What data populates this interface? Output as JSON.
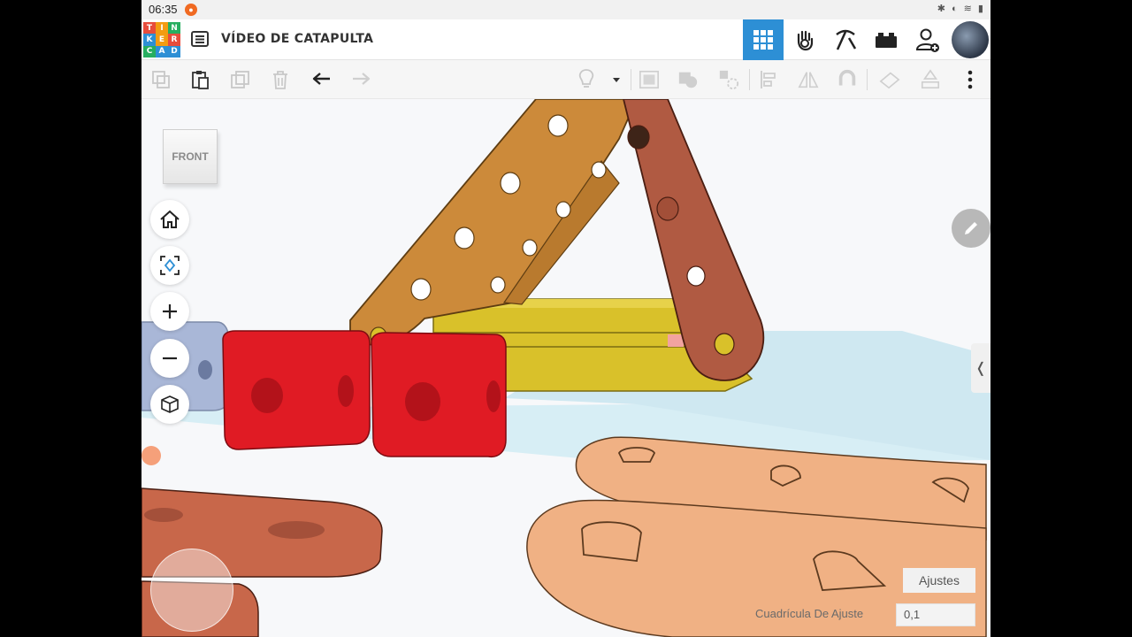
{
  "statusbar": {
    "time": "06:35"
  },
  "header": {
    "logo_letters": [
      "T",
      "I",
      "N",
      "K",
      "E",
      "R",
      "C",
      "A",
      "D"
    ],
    "logo_colors": [
      "#e74c3c",
      "#f39c12",
      "#27ae60",
      "#2d8fd5",
      "#f39c12",
      "#e74c3c",
      "#27ae60",
      "#2d8fd5",
      "#2d8fd5"
    ],
    "title": "VÍDEO DE CATAPULTA",
    "buttons": [
      {
        "icon": "grid-view-icon",
        "active": true
      },
      {
        "icon": "hand-sim-icon",
        "active": false
      },
      {
        "icon": "pickaxe-icon",
        "active": false
      },
      {
        "icon": "brick-icon",
        "active": false
      },
      {
        "icon": "add-user-icon",
        "active": false
      }
    ]
  },
  "toolbar": {
    "items": [
      "copy-icon",
      "paste-icon",
      "duplicate-icon",
      "delete-icon",
      "undo-icon",
      "redo-icon",
      "light-icon",
      "dropdown-icon",
      "group-icon",
      "ungroup-icon",
      "hole-icon",
      "align-icon",
      "mirror-icon",
      "magnet-icon",
      "cruise-icon",
      "workplane-icon",
      "more-icon"
    ]
  },
  "viewcube": {
    "label": "FRONT"
  },
  "nav": [
    "home-icon",
    "fit-view-icon",
    "zoom-in-icon",
    "zoom-out-icon",
    "perspective-icon"
  ],
  "settings": {
    "button_label": "Ajustes",
    "snap_label": "Cuadrícula De Ajuste",
    "snap_value": "0,1"
  },
  "colors": {
    "accent": "#2d8fd5",
    "orange_arm": "#cc8a3a",
    "brown_arm": "#b05a42",
    "yellow_base": "#d9c12a",
    "red_cube": "#e01b24",
    "peach_parts": "#f0b184",
    "terracotta_parts": "#c8674a",
    "grid_plane": "#cfe9f2"
  }
}
